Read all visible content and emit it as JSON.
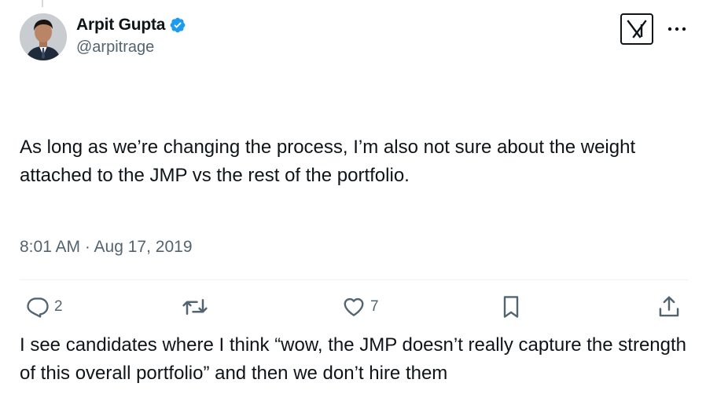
{
  "tweet": {
    "author": {
      "display_name": "Arpit Gupta",
      "handle": "@arpitrage",
      "verified": true,
      "verified_color": "#1d9bf0"
    },
    "paragraphs": [
      "As long as we’re changing the process, I’m also not sure about the weight attached to the JMP vs the rest of the portfolio.",
      "I see candidates where I think “wow, the JMP doesn’t really capture the strength of this overall portfolio” and then we don’t hire them"
    ],
    "timestamp": "8:01 AM · Aug 17, 2019"
  },
  "actions": {
    "reply_count": "2",
    "retweet_count": "",
    "like_count": "7"
  },
  "icons": {
    "brand": "x-logo-icon",
    "more": "more-horizontal-icon",
    "reply": "reply-icon",
    "retweet": "retweet-icon",
    "like": "heart-icon",
    "bookmark": "bookmark-icon",
    "share": "share-icon"
  },
  "colors": {
    "text_primary": "#0f1419",
    "text_secondary": "#536471",
    "divider": "#eff3f4"
  }
}
